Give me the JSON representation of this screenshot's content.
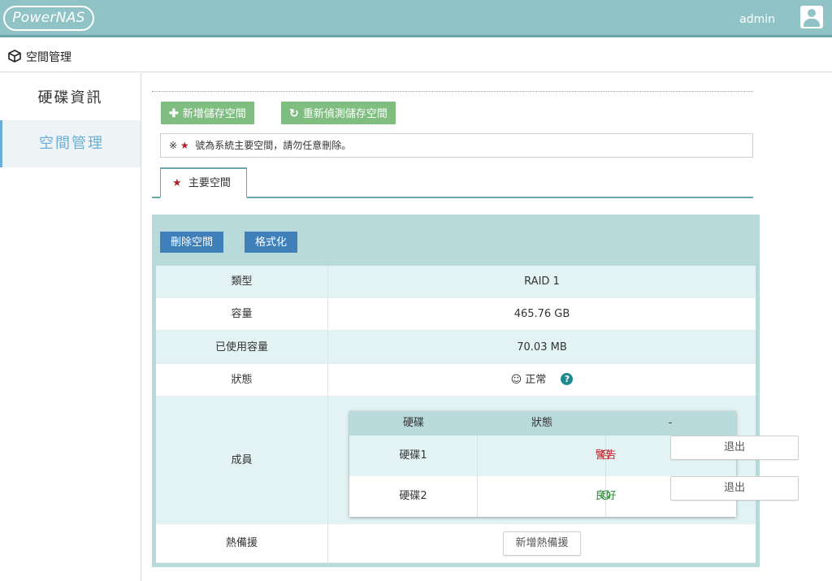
{
  "app": {
    "logo": "PowerNAS",
    "username": "admin"
  },
  "breadcrumb": {
    "title": "空間管理",
    "icon": "cube-icon"
  },
  "sidebar": {
    "items": [
      {
        "label": "硬碟資訊",
        "active": false
      },
      {
        "label": "空間管理",
        "active": true
      }
    ]
  },
  "toolbar": {
    "add_label": "新增儲存空間",
    "redetect_label": "重新偵測儲存空間",
    "notice_prefix": "※",
    "notice_text": "號為系統主要空間，請勿任意刪除。"
  },
  "tab": {
    "label": "主要空間"
  },
  "actions": {
    "delete_label": "刪除空間",
    "format_label": "格式化"
  },
  "details": {
    "type_label": "類型",
    "type_value": "RAID 1",
    "capacity_label": "容量",
    "capacity_value": "465.76 GB",
    "used_label": "已使用容量",
    "used_value": "70.03 MB",
    "status_label": "狀態",
    "status_value": "正常",
    "members_label": "成員",
    "spare_label": "熱備援",
    "spare_button": "新增熱備援"
  },
  "members": {
    "headers": [
      "硬碟",
      "狀態",
      "-"
    ],
    "rows": [
      {
        "disk": "硬碟1",
        "status": "警告",
        "action": "退出"
      },
      {
        "disk": "硬碟2",
        "status": "良好",
        "action": "退出"
      }
    ]
  },
  "colors": {
    "topbar": "#8fc3c5",
    "green_button": "#7fbd81",
    "blue_button": "#3f7fba",
    "warning": "#c0262e",
    "good": "#2e8b3a",
    "star": "#b0212b"
  }
}
